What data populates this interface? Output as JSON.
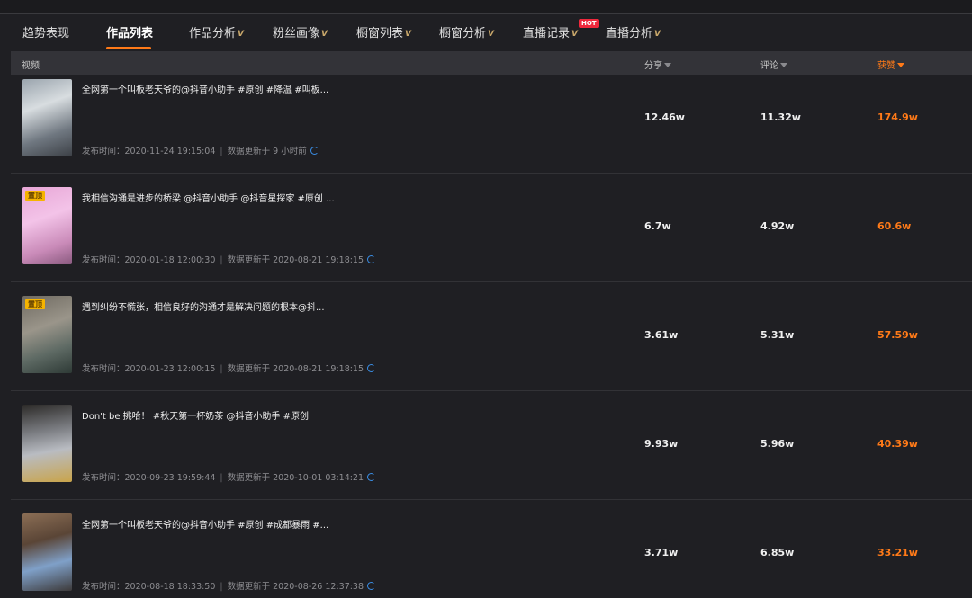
{
  "tabs": [
    {
      "label": "趋势表现",
      "vip": ""
    },
    {
      "label": "作品列表",
      "vip": ""
    },
    {
      "label": "作品分析",
      "vip": "V"
    },
    {
      "label": "粉丝画像",
      "vip": "V"
    },
    {
      "label": "橱窗列表",
      "vip": "V"
    },
    {
      "label": "橱窗分析",
      "vip": "V"
    },
    {
      "label": "直播记录",
      "vip": "V"
    },
    {
      "label": "直播分析",
      "vip": "V"
    }
  ],
  "hot_badge": "HOT",
  "table": {
    "headers": {
      "video": "视频",
      "shares": "分享",
      "comments": "评论",
      "likes": "获赞"
    },
    "rows": [
      {
        "title": "全网第一个叫板老天爷的@抖音小助手 #原创 #降温 #叫板...",
        "publish": "发布时间：2020-11-24 19:15:04",
        "update": "数据更新于 9 小时前",
        "pinned": false,
        "shares": "12.46w",
        "comments": "11.32w",
        "likes": "174.9w"
      },
      {
        "title": "我相信沟通是进步的桥梁 @抖音小助手 @抖音星探家 #原创 ...",
        "publish": "发布时间：2020-01-18 12:00:30",
        "update": "数据更新于 2020-08-21 19:18:15",
        "pinned": true,
        "shares": "6.7w",
        "comments": "4.92w",
        "likes": "60.6w"
      },
      {
        "title": "遇到纠纷不慌张，相信良好的沟通才是解决问题的根本@抖...",
        "publish": "发布时间：2020-01-23 12:00:15",
        "update": "数据更新于 2020-08-21 19:18:15",
        "pinned": true,
        "shares": "3.61w",
        "comments": "5.31w",
        "likes": "57.59w"
      },
      {
        "title": "Don't be 挑哈！ #秋天第一杯奶茶 @抖音小助手 #原创",
        "publish": "发布时间：2020-09-23 19:59:44",
        "update": "数据更新于 2020-10-01 03:14:21",
        "pinned": false,
        "shares": "9.93w",
        "comments": "5.96w",
        "likes": "40.39w"
      },
      {
        "title": "全网第一个叫板老天爷的@抖音小助手 #原创 #成都暴雨 #...",
        "publish": "发布时间：2020-08-18 18:33:50",
        "update": "数据更新于 2020-08-26 12:37:38",
        "pinned": false,
        "shares": "3.71w",
        "comments": "6.85w",
        "likes": "33.21w"
      }
    ]
  },
  "pinned_label": "置顶",
  "colors": {
    "accent": "#ff7a18",
    "background": "#1f1f23",
    "header": "#333338",
    "refresh": "#3a8ee6",
    "hot": "#f0283c"
  }
}
